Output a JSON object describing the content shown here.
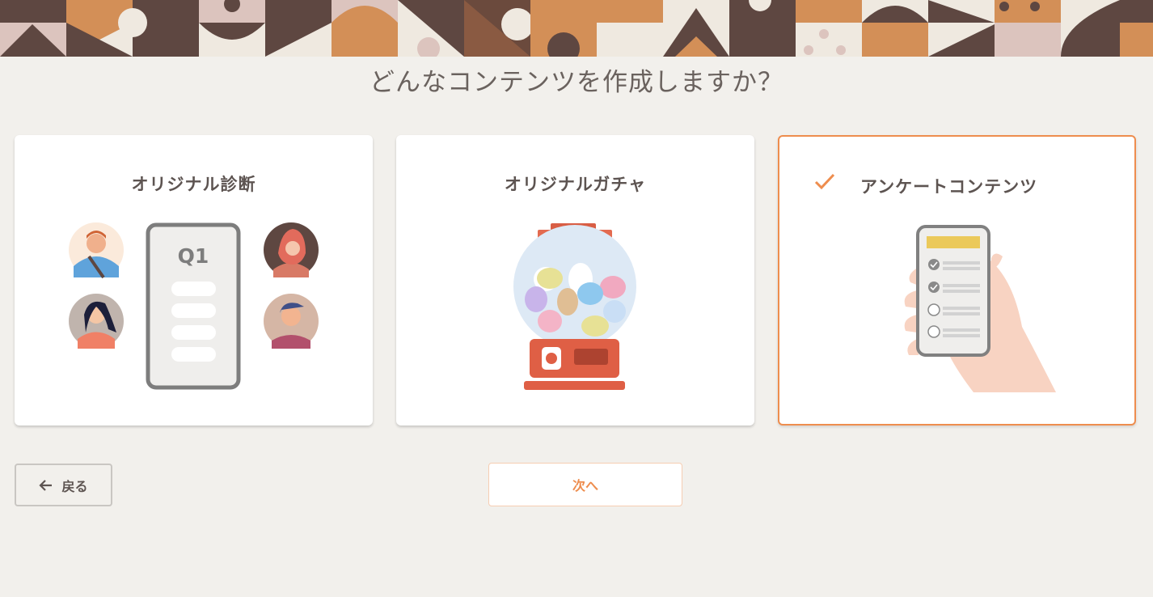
{
  "header": {
    "title": "どんなコンテンツを作成しますか？"
  },
  "options": [
    {
      "id": "diagnosis",
      "label": "オリジナル診断",
      "illustration_text": "Q1",
      "selected": false
    },
    {
      "id": "gacha",
      "label": "オリジナルガチャ",
      "selected": false
    },
    {
      "id": "survey",
      "label": "アンケートコンテンツ",
      "selected": true
    }
  ],
  "footer": {
    "back_label": "戻る",
    "next_label": "次へ"
  },
  "colors": {
    "accent": "#ee8d4e",
    "background": "#f2f0ec",
    "text": "#5d5451",
    "banner_dark": "#5e4741",
    "banner_orange": "#d38f57",
    "banner_pink": "#dcc4be",
    "banner_cream": "#efe9e0"
  },
  "icons": {
    "check": "check-icon",
    "back_arrow": "arrow-left-icon"
  }
}
